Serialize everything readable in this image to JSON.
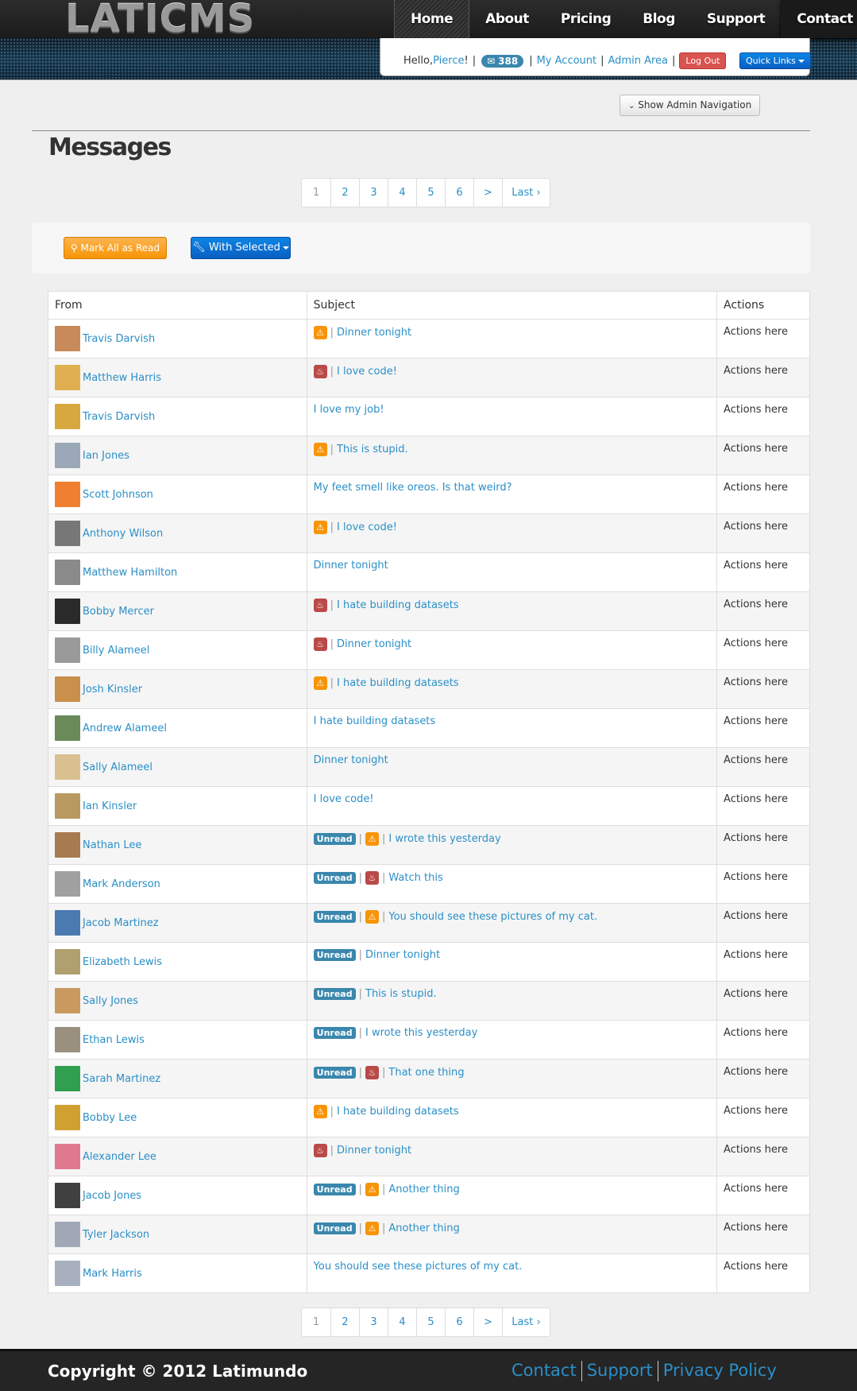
{
  "header": {
    "logo": "LATICMS",
    "nav": [
      "Home",
      "About",
      "Pricing",
      "Blog",
      "Support",
      "Contact"
    ],
    "greeting": "Hello, ",
    "user": "Pierce",
    "greeting_end": "!",
    "message_count": "388",
    "my_account": "My Account",
    "admin_area": "Admin Area",
    "logout": "Log Out",
    "quick_links": "Quick Links"
  },
  "admin_nav_toggle": "Show Admin Navigation",
  "page_title": "Messages",
  "pagination": [
    "1",
    "2",
    "3",
    "4",
    "5",
    "6",
    ">",
    "Last ›"
  ],
  "toolbar": {
    "mark_all": "Mark All as Read",
    "with_selected": "With Selected"
  },
  "table": {
    "headers": [
      "From",
      "Subject",
      "Actions"
    ],
    "unread_label": "Unread",
    "rows": [
      {
        "from": "Travis Darvish",
        "avatar": "#c88a5a",
        "unread": false,
        "icon": "warning-icon",
        "subject": "Dinner tonight",
        "actions": "Actions here"
      },
      {
        "from": "Matthew Harris",
        "avatar": "#e0b050",
        "unread": false,
        "icon": "fire-icon",
        "subject": "I love code!",
        "actions": "Actions here"
      },
      {
        "from": "Travis Darvish",
        "avatar": "#d8a840",
        "unread": false,
        "icon": "",
        "subject": "I love my job!",
        "actions": "Actions here"
      },
      {
        "from": "Ian Jones",
        "avatar": "#9aa8b8",
        "unread": false,
        "icon": "warning-icon",
        "subject": "This is stupid.",
        "actions": "Actions here"
      },
      {
        "from": "Scott Johnson",
        "avatar": "#f08030",
        "unread": false,
        "icon": "",
        "subject": "My feet smell like oreos. Is that weird?",
        "actions": "Actions here"
      },
      {
        "from": "Anthony Wilson",
        "avatar": "#777777",
        "unread": false,
        "icon": "warning-icon",
        "subject": "I love code!",
        "actions": "Actions here"
      },
      {
        "from": "Matthew Hamilton",
        "avatar": "#8a8a8a",
        "unread": false,
        "icon": "",
        "subject": "Dinner tonight",
        "actions": "Actions here"
      },
      {
        "from": "Bobby Mercer",
        "avatar": "#2a2a2a",
        "unread": false,
        "icon": "fire-icon",
        "subject": "I hate building datasets",
        "actions": "Actions here"
      },
      {
        "from": "Billy Alameel",
        "avatar": "#9a9a9a",
        "unread": false,
        "icon": "fire-icon",
        "subject": "Dinner tonight",
        "actions": "Actions here"
      },
      {
        "from": "Josh Kinsler",
        "avatar": "#c8904a",
        "unread": false,
        "icon": "warning-icon",
        "subject": "I hate building datasets",
        "actions": "Actions here"
      },
      {
        "from": "Andrew Alameel",
        "avatar": "#6a8a5a",
        "unread": false,
        "icon": "",
        "subject": "I hate building datasets",
        "actions": "Actions here"
      },
      {
        "from": "Sally Alameel",
        "avatar": "#d8c090",
        "unread": false,
        "icon": "",
        "subject": "Dinner tonight",
        "actions": "Actions here"
      },
      {
        "from": "Ian Kinsler",
        "avatar": "#b89a60",
        "unread": false,
        "icon": "",
        "subject": "I love code!",
        "actions": "Actions here"
      },
      {
        "from": "Nathan Lee",
        "avatar": "#a87a50",
        "unread": true,
        "icon": "warning-icon",
        "subject": "I wrote this yesterday",
        "actions": "Actions here"
      },
      {
        "from": "Mark Anderson",
        "avatar": "#a0a0a0",
        "unread": true,
        "icon": "fire-icon",
        "subject": "Watch this",
        "actions": "Actions here"
      },
      {
        "from": "Jacob Martinez",
        "avatar": "#4a7ab0",
        "unread": true,
        "icon": "warning-icon",
        "subject": "You should see these pictures of my cat.",
        "actions": "Actions here"
      },
      {
        "from": "Elizabeth Lewis",
        "avatar": "#b0a070",
        "unread": true,
        "icon": "",
        "subject": "Dinner tonight",
        "actions": "Actions here"
      },
      {
        "from": "Sally Jones",
        "avatar": "#c89a60",
        "unread": true,
        "icon": "",
        "subject": "This is stupid.",
        "actions": "Actions here"
      },
      {
        "from": "Ethan Lewis",
        "avatar": "#9a9080",
        "unread": true,
        "icon": "",
        "subject": "I wrote this yesterday",
        "actions": "Actions here"
      },
      {
        "from": "Sarah Martinez",
        "avatar": "#30a050",
        "unread": true,
        "icon": "fire-icon",
        "subject": "That one thing",
        "actions": "Actions here"
      },
      {
        "from": "Bobby Lee",
        "avatar": "#d0a030",
        "unread": false,
        "icon": "warning-icon",
        "subject": "I hate building datasets",
        "actions": "Actions here"
      },
      {
        "from": "Alexander Lee",
        "avatar": "#e07890",
        "unread": false,
        "icon": "fire-icon",
        "subject": "Dinner tonight",
        "actions": "Actions here"
      },
      {
        "from": "Jacob Jones",
        "avatar": "#404040",
        "unread": true,
        "icon": "warning-icon",
        "subject": "Another thing",
        "actions": "Actions here"
      },
      {
        "from": "Tyler Jackson",
        "avatar": "#a0a8b8",
        "unread": true,
        "icon": "warning-icon",
        "subject": "Another thing",
        "actions": "Actions here"
      },
      {
        "from": "Mark Harris",
        "avatar": "#a8b0c0",
        "unread": false,
        "icon": "",
        "subject": "You should see these pictures of my cat.",
        "actions": "Actions here"
      }
    ]
  },
  "footer": {
    "copyright": "Copyright © 2012 Latimundo",
    "links": [
      "Contact",
      "Support",
      "Privacy Policy"
    ]
  }
}
